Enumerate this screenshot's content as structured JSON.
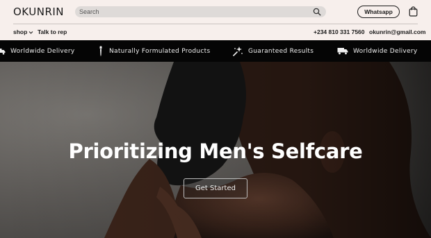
{
  "header": {
    "logo": "OKUNRIN",
    "search": {
      "placeholder": "Search"
    },
    "whatsapp_label": "Whatsapp"
  },
  "subnav": {
    "shop_label": "shop",
    "talk_label": "Talk to rep",
    "phone": "+234 810 331 7560",
    "email": "okunrin@gmail.com"
  },
  "features": [
    {
      "label": "Worldwide Delivery",
      "icon": "truck-icon"
    },
    {
      "label": "Naturally Formulated Products",
      "icon": "dropper-icon"
    },
    {
      "label": "Guaranteed Results",
      "icon": "sparkle-icon"
    },
    {
      "label": "Worldwide Delivery",
      "icon": "truck-icon"
    }
  ],
  "hero": {
    "title": "Prioritizing Men's Selfcare",
    "cta_label": "Get Started"
  },
  "colors": {
    "page_bg": "#f7efec",
    "band_bg": "#050505",
    "text": "#1a1a1a"
  }
}
